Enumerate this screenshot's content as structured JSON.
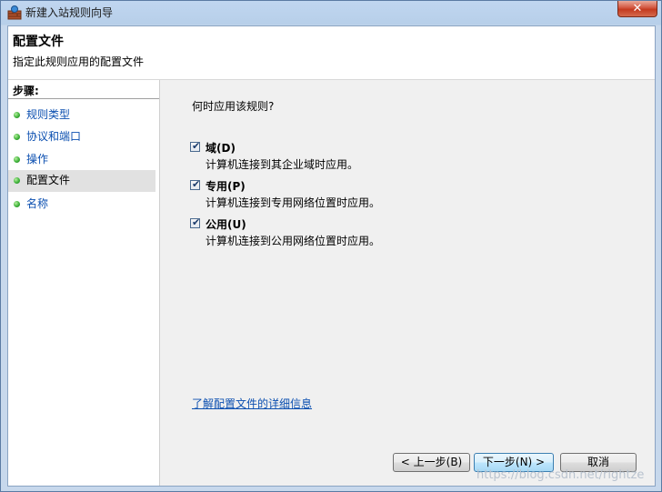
{
  "window": {
    "title": "新建入站规则向导",
    "close_glyph": "✕"
  },
  "header": {
    "title": "配置文件",
    "subtitle": "指定此规则应用的配置文件"
  },
  "steps": {
    "heading": "步骤:",
    "items": [
      {
        "label": "规则类型",
        "selected": false
      },
      {
        "label": "协议和端口",
        "selected": false
      },
      {
        "label": "操作",
        "selected": false
      },
      {
        "label": "配置文件",
        "selected": true
      },
      {
        "label": "名称",
        "selected": false
      }
    ]
  },
  "main": {
    "question": "何时应用该规则?",
    "options": [
      {
        "label": "域(D)",
        "description": "计算机连接到其企业域时应用。",
        "checked": true
      },
      {
        "label": "专用(P)",
        "description": "计算机连接到专用网络位置时应用。",
        "checked": true
      },
      {
        "label": "公用(U)",
        "description": "计算机连接到公用网络位置时应用。",
        "checked": true
      }
    ],
    "link": "了解配置文件的详细信息"
  },
  "buttons": {
    "back": "< 上一步(B)",
    "next": "下一步(N) >",
    "cancel": "取消"
  },
  "watermark": "https://blog.csdn.net/rightze",
  "icons": {
    "app": "firewall-wizard-icon",
    "checkbox": "check-icon",
    "step_bullet": "green-dot-icon"
  },
  "colors": {
    "link": "#0b4fb0",
    "selected_step_bg": "#e1e1e1",
    "close": "#c43a1f"
  }
}
